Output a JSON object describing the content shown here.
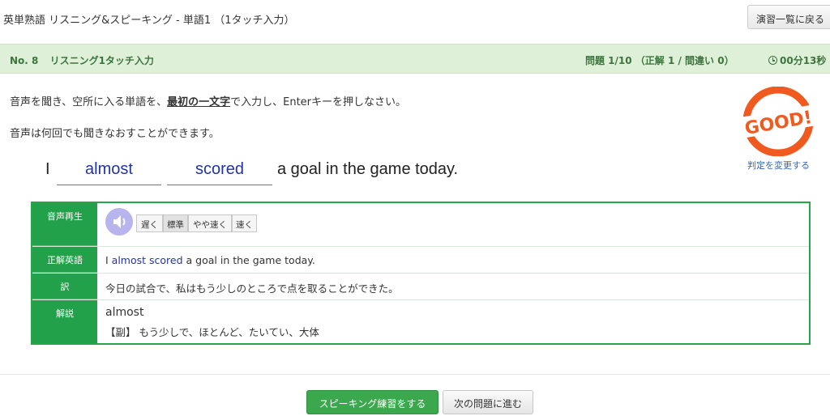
{
  "header": {
    "title": "英単熟語 リスニング&スピーキング - 単語1 （1タッチ入力）",
    "back_button": "演習一覧に戻る"
  },
  "question_bar": {
    "number": "No. 8",
    "mode": "リスニング1タッチ入力",
    "progress": "問題 1/10 （正解 1 / 間違い 0）",
    "timer": "00分13秒"
  },
  "instructions": {
    "line1_before": "音声を聞き、空所に入る単語を、",
    "line1_emphasis": "最初の一文字",
    "line1_after": "で入力し、Enterキーを押しなさい。",
    "line2": "音声は何回でも聞きなおすことができます。"
  },
  "judge": {
    "stamp_text": "GOOD!",
    "change_link": "判定を変更する"
  },
  "sentence": {
    "prefix": "I",
    "blank1": "almost",
    "blank2": "scored",
    "suffix": "a goal in the game today."
  },
  "details": {
    "audio_label": "音声再生",
    "speeds": [
      "遅く",
      "標準",
      "やや速く",
      "速く"
    ],
    "selected_speed": "標準",
    "answer_label": "正解英語",
    "answer_prefix": "I",
    "answer_highlight": "almost scored",
    "answer_suffix": "a goal in the game today.",
    "translation_label": "訳",
    "translation": "今日の試合で、私はもう少しのところで点を取ることができた。",
    "explanation_label": "解説",
    "explanation_word": "almost",
    "explanation_text": "【副】 もう少しで、ほとんど、たいてい、大体"
  },
  "footer": {
    "speak_button": "スピーキング練習をする",
    "next_button": "次の問題に進む"
  },
  "colors": {
    "accent_green": "#22a04a",
    "bar_green": "#dff0d8",
    "answer_blue": "#2233aa",
    "stamp_orange": "#f05a1e"
  }
}
